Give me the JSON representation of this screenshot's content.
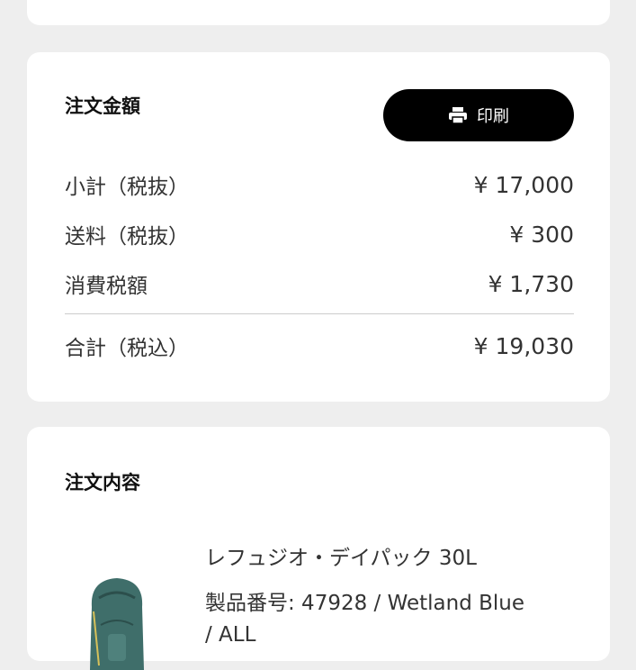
{
  "summary": {
    "title": "注文金額",
    "print_label": "印刷",
    "subtotal_label": "小計（税抜）",
    "subtotal_value": "¥ 17,000",
    "shipping_label": "送料（税抜）",
    "shipping_value": "¥ 300",
    "tax_label": "消費税額",
    "tax_value": "¥ 1,730",
    "total_label": "合計（税込）",
    "total_value": "¥ 19,030"
  },
  "order_items": {
    "title": "注文内容",
    "product_name": "レフュジオ・デイパック 30L",
    "product_detail": "製品番号: 47928 / Wetland Blue",
    "product_detail_cont": "/ ALL"
  },
  "icons": {
    "print": "printer-icon"
  },
  "colors": {
    "background": "#eeeeee",
    "card": "#ffffff",
    "button": "#000000",
    "product": "#3f6e6a"
  }
}
